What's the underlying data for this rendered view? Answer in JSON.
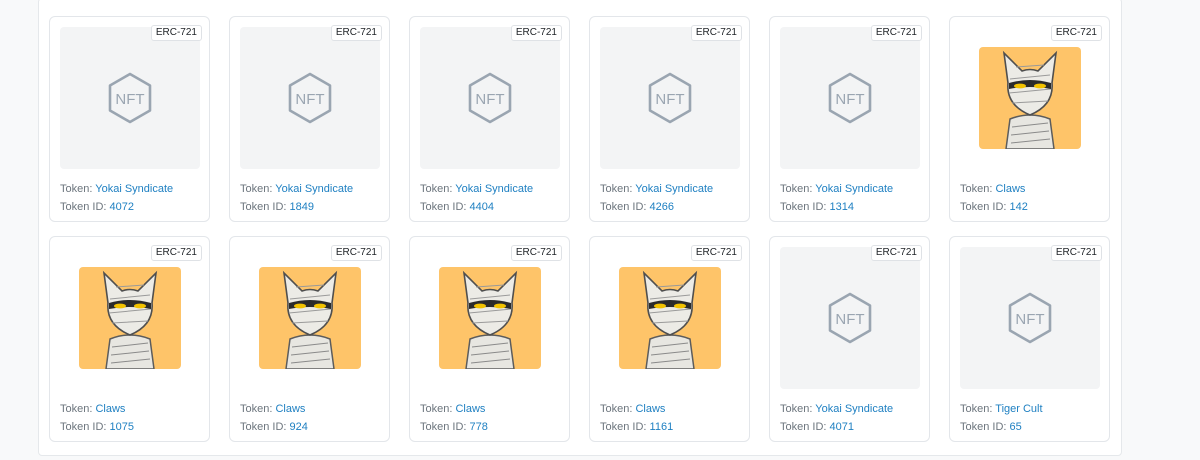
{
  "token_prefix": "Token: ",
  "token_id_prefix": "Token ID: ",
  "cards": [
    {
      "standard": "ERC-721",
      "token": "Yokai Syndicate",
      "token_id": "4072",
      "image": "nft-placeholder-icon"
    },
    {
      "standard": "ERC-721",
      "token": "Yokai Syndicate",
      "token_id": "1849",
      "image": "nft-placeholder-icon"
    },
    {
      "standard": "ERC-721",
      "token": "Yokai Syndicate",
      "token_id": "4404",
      "image": "nft-placeholder-icon"
    },
    {
      "standard": "ERC-721",
      "token": "Yokai Syndicate",
      "token_id": "4266",
      "image": "nft-placeholder-icon"
    },
    {
      "standard": "ERC-721",
      "token": "Yokai Syndicate",
      "token_id": "1314",
      "image": "nft-placeholder-icon"
    },
    {
      "standard": "ERC-721",
      "token": "Claws",
      "token_id": "142",
      "image": "mummy-cat-art"
    },
    {
      "standard": "ERC-721",
      "token": "Claws",
      "token_id": "1075",
      "image": "mummy-cat-art"
    },
    {
      "standard": "ERC-721",
      "token": "Claws",
      "token_id": "924",
      "image": "mummy-cat-art"
    },
    {
      "standard": "ERC-721",
      "token": "Claws",
      "token_id": "778",
      "image": "mummy-cat-art"
    },
    {
      "standard": "ERC-721",
      "token": "Claws",
      "token_id": "1161",
      "image": "mummy-cat-art"
    },
    {
      "standard": "ERC-721",
      "token": "Yokai Syndicate",
      "token_id": "4071",
      "image": "nft-placeholder-icon"
    },
    {
      "standard": "ERC-721",
      "token": "Tiger Cult",
      "token_id": "65",
      "image": "nft-placeholder-icon"
    }
  ],
  "colors": {
    "link": "#1f80c2",
    "art_background": "#fec469",
    "placeholder_background": "#f3f4f5",
    "placeholder_icon": "#9aa5b1"
  }
}
